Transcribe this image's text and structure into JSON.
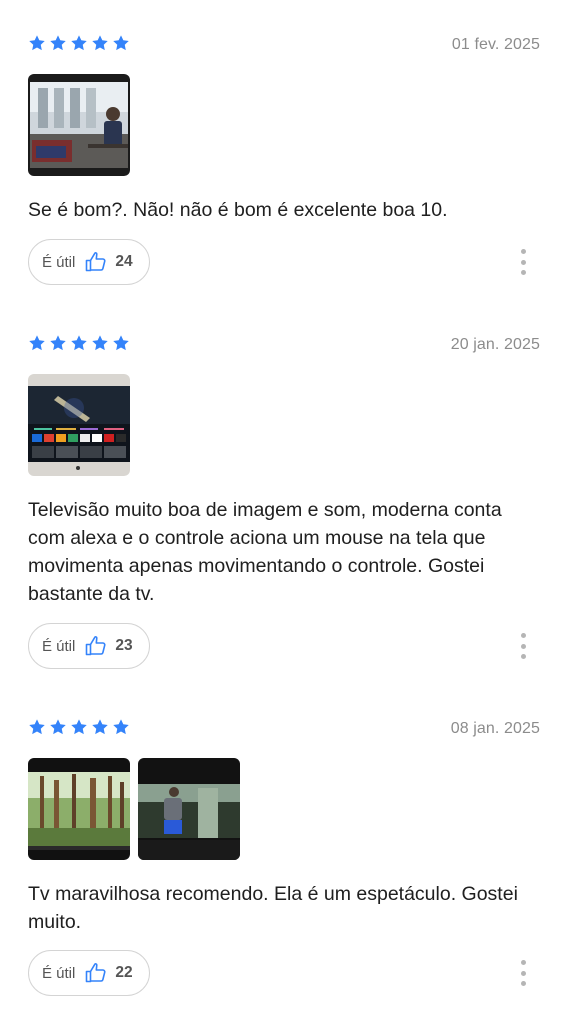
{
  "colors": {
    "star": "#3483fa",
    "thumb": "#3483fa",
    "date": "#8c8c8c"
  },
  "reviews": [
    {
      "rating": 5,
      "date": "01 fev. 2025",
      "photos": [
        "photo-tv-office-scene"
      ],
      "text": "Se é bom?. Não! não é bom é excelente boa 10.",
      "helpful_label": "É útil",
      "helpful_count": "24"
    },
    {
      "rating": 5,
      "date": "20 jan. 2025",
      "photos": [
        "photo-tv-home-screen"
      ],
      "text": "Televisão muito boa de imagem e som, moderna conta com alexa e o controle aciona um mouse na tela que movimenta apenas movimentando o controle. Gostei bastante da tv.",
      "helpful_label": "É útil",
      "helpful_count": "23"
    },
    {
      "rating": 5,
      "date": "08 jan. 2025",
      "photos": [
        "photo-tv-forest-scene",
        "photo-tv-runner-scene"
      ],
      "text": "Tv maravilhosa recomendo. Ela é um espetáculo. Gostei muito.",
      "helpful_label": "É útil",
      "helpful_count": "22"
    }
  ]
}
